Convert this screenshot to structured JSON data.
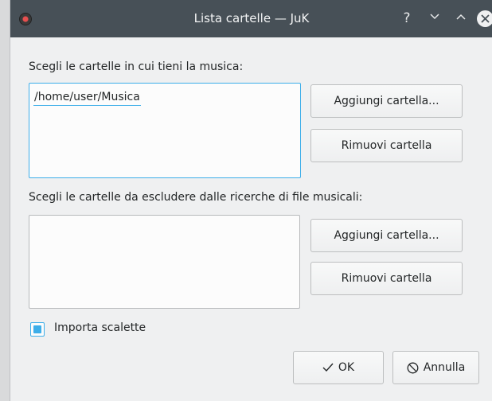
{
  "window": {
    "title": "Lista cartelle — JuK",
    "help_glyph": "?"
  },
  "music_folders": {
    "label": "Scegli le cartelle in cui tieni la musica:",
    "items": [
      "/home/user/Musica"
    ],
    "add_label": "Aggiungi cartella...",
    "remove_label": "Rimuovi cartella"
  },
  "excluded_folders": {
    "label": "Scegli le cartelle da escludere dalle ricerche di file musicali:",
    "items": [],
    "add_label": "Aggiungi cartella...",
    "remove_label": "Rimuovi cartella"
  },
  "import_playlists": {
    "label": "Importa scalette",
    "checked": true
  },
  "footer": {
    "ok_label": "OK",
    "cancel_label": "Annulla"
  },
  "colors": {
    "titlebar": "#475057",
    "accent": "#3daee9",
    "window_bg": "#eff0f1"
  },
  "icons": {
    "app": "juk-app-icon",
    "help": "help-icon",
    "minimize": "chevron-down-icon",
    "maximize": "chevron-up-icon",
    "close": "close-icon",
    "ok": "checkmark-icon",
    "cancel": "cancel-icon"
  }
}
